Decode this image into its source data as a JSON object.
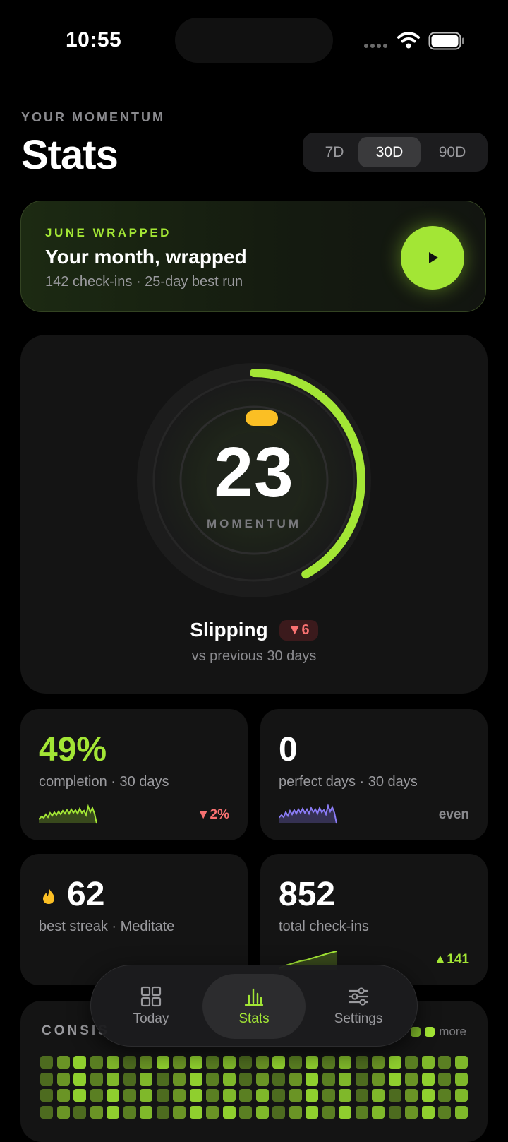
{
  "status_bar": {
    "time": "10:55"
  },
  "header": {
    "eyebrow": "YOUR MOMENTUM",
    "title": "Stats"
  },
  "range_selector": {
    "options": [
      "7D",
      "30D",
      "90D"
    ],
    "selected": "30D"
  },
  "wrapped": {
    "eyebrow": "JUNE WRAPPED",
    "title": "Your month, wrapped",
    "subtitle": "142 check-ins · 25-day best run",
    "play_icon": "play-icon"
  },
  "momentum": {
    "score": "23",
    "label": "MOMENTUM",
    "status": "Slipping",
    "delta": "▼6",
    "comparison": "vs previous 30 days",
    "ring_fill_fraction": 0.42
  },
  "stats": [
    {
      "value": "49%",
      "label": "completion · 30 days",
      "delta": "▼2%",
      "value_color": "#a3e635",
      "delta_color": "#f87171",
      "spark_color": "#a3e635"
    },
    {
      "value": "0",
      "label": "perfect days · 30 days",
      "delta": "even",
      "value_color": "#ffffff",
      "delta_color": "#8a8a8e",
      "spark_color": "#8b7cf6"
    },
    {
      "value": "62",
      "label": "best streak · Meditate",
      "delta": "",
      "value_color": "#ffffff",
      "icon": "flame-icon"
    },
    {
      "value": "852",
      "label": "total check-ins",
      "delta": "▲141",
      "value_color": "#ffffff",
      "delta_color": "#a3e635",
      "spark_color": "#a3e635"
    }
  ],
  "consistency": {
    "title": "CONSIS",
    "legend_more": "more"
  },
  "tabbar": {
    "items": [
      {
        "label": "Today",
        "icon": "grid-icon"
      },
      {
        "label": "Stats",
        "icon": "bar-chart-icon"
      },
      {
        "label": "Settings",
        "icon": "sliders-icon"
      }
    ],
    "active": "Stats"
  },
  "colors": {
    "accent": "#a3e635",
    "negative": "#f87171",
    "flame": "#fbbf24",
    "purple": "#8b7cf6"
  }
}
